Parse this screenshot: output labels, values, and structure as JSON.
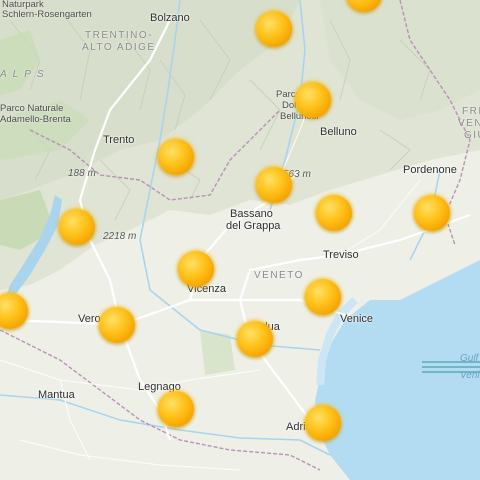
{
  "map": {
    "labels": {
      "bolzano": "Bolzano",
      "trentino": "TRENTINO-",
      "altoadige": "ALTO ADIGE",
      "trento": "Trento",
      "belluno": "Belluno",
      "pordenone": "Pordenone",
      "bassano1": "Bassano",
      "bassano2": "del Grappa",
      "treviso": "Treviso",
      "veneto": "VENETO",
      "vicenza": "Vicenza",
      "venice": "Venice",
      "padua": "Padua",
      "verona": "Verona",
      "legnago": "Legnago",
      "mantua": "Mantua",
      "adria": "Adria",
      "alps": "ALPS",
      "park1a": "Parco Naturale",
      "park1b": "Adamello-Brenta",
      "park2a": "Naturpark",
      "park2b": "Schlern-Rosengarten",
      "park3a": "Parco",
      "park3b": "Dolomiti",
      "park3c": "Bellunesi",
      "friuli1": "FRIULI",
      "friuli2": "VENEZIA",
      "friuli3": "GIULIA",
      "elev1": "188 m",
      "elev2": "2218 m",
      "elev3": "563 m",
      "gulf1": "Gulf of",
      "gulf2": "Venice"
    },
    "marker_count": 17,
    "colors": {
      "land": "#eef0e8",
      "mountain": "#dfe4d6",
      "water": "#b3dcf2",
      "marker": "#ffb400",
      "road": "#ffffff"
    }
  }
}
